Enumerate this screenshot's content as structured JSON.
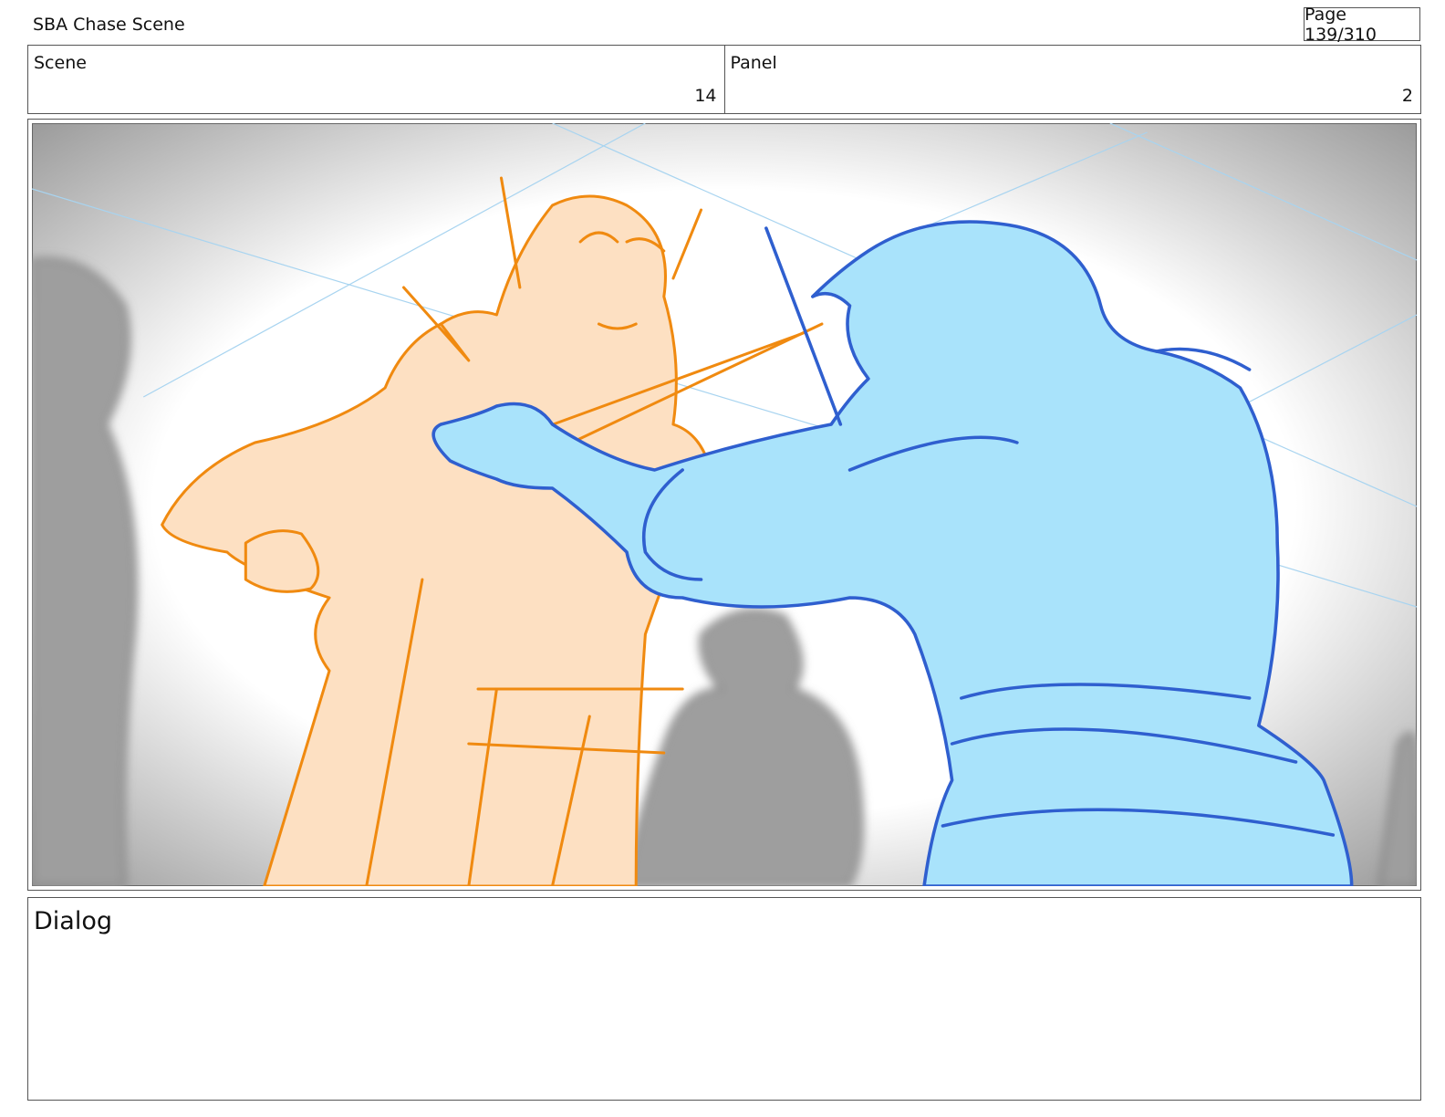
{
  "header": {
    "title": "SBA Chase Scene",
    "page_label": "Page 139/310"
  },
  "info": {
    "scene_label": "Scene",
    "scene_value": "14",
    "panel_label": "Panel",
    "panel_value": "2"
  },
  "dialog": {
    "label": "Dialog"
  },
  "colors": {
    "orange_line": "#f08a10",
    "orange_fill": "#fde0c2",
    "blue_line": "#2f5fcf",
    "blue_fill": "#a9e3fb",
    "gray_figures": "#9a9a9a"
  }
}
